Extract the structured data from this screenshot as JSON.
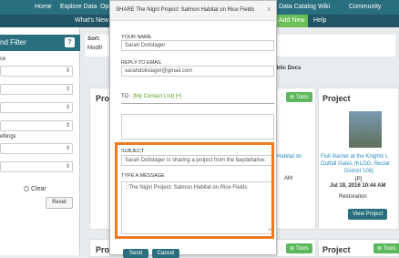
{
  "topnav": {
    "items": [
      "Home",
      "Explore Data",
      "Ope",
      "Data Catalog",
      "Wiki",
      "Community"
    ]
  },
  "subnav": {
    "items": [
      "What's New",
      "Add New",
      "Help"
    ]
  },
  "filter": {
    "title": "nd Filter",
    "help": "?",
    "labels": [
      "ce",
      "ettings"
    ],
    "clear_label": "Clear",
    "reset_label": "Reset"
  },
  "sort": {
    "label": "Sort:",
    "value": "Modifi"
  },
  "public_docs": "ublic Docs",
  "cards": {
    "left_title": "Proj",
    "right_title": "Project",
    "tools_label": "Tools",
    "left_bottom_title": "Proj",
    "right_bottom_title": "Project"
  },
  "right_card": {
    "link_line1": "Fish Barrier at the Knights L",
    "link_line2": "Outfall Gates (KLOG, Reclar",
    "link_line3": "District 108)",
    "badge": "[P]",
    "date": "Jul 19, 2016 10:44 AM",
    "type": "Restoration",
    "view_label": "View Project"
  },
  "middle_card": {
    "link": "Habitat on",
    "time": "AM"
  },
  "modal": {
    "title": "SHARE The Nigiri Project: Salmon Habitat on Rice Fields",
    "close": "x",
    "your_name_label": "YOUR NAME",
    "your_name_value": "Sarah Dolislager",
    "reply_label": "REPLY-TO EMAIL",
    "reply_value": "sarahdolislager@gmail.com",
    "to_label": "TO :",
    "to_link": "[My Contact List]",
    "to_plus": "[+]",
    "subject_label": "SUBJECT",
    "subject_value": "Sarah Dolislager is sharing a project from the baydeltalive.",
    "message_label": "TYPE A MESSAGE",
    "message_value": "::The Nigiri Project: Salmon Habitat on Rice Fields",
    "send_label": "Send",
    "cancel_label": "Cancel"
  },
  "colors": {
    "nav": "#2a6f7f",
    "subnav": "#1f5564",
    "accent_green": "#6bbf59",
    "highlight": "#f07a22"
  }
}
